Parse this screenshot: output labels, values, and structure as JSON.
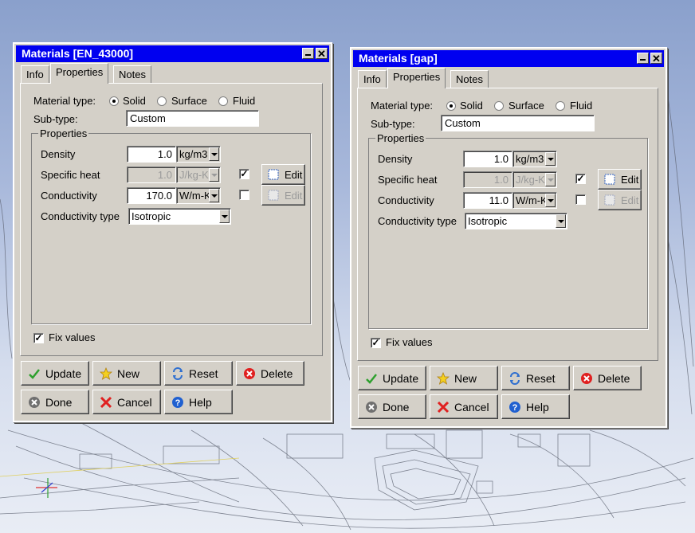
{
  "colors": {
    "titlebar": "#0000f0",
    "dialog_bg": "#d4d0c8",
    "desktop_top": "#8aa0cc"
  },
  "dialogs": [
    {
      "title": "Materials [EN_43000]",
      "tabs": [
        "Info",
        "Properties",
        "Notes"
      ],
      "active_tab": "Properties",
      "material_type_label": "Material type:",
      "material_types": [
        "Solid",
        "Surface",
        "Fluid"
      ],
      "material_type_selected": "Solid",
      "subtype_label": "Sub-type:",
      "subtype_value": "Custom",
      "properties_label": "Properties",
      "density": {
        "label": "Density",
        "value": "1.0",
        "unit": "kg/m3"
      },
      "specific_heat": {
        "label": "Specific heat",
        "value": "1.0",
        "unit": "J/kg-K",
        "checked": true,
        "edit_label": "Edit"
      },
      "conductivity": {
        "label": "Conductivity",
        "value": "170.0",
        "unit": "W/m-K",
        "checked": false,
        "edit_label": "Edit"
      },
      "conductivity_type": {
        "label": "Conductivity type",
        "value": "Isotropic"
      },
      "fix_values": {
        "label": "Fix values",
        "checked": true
      },
      "buttons": {
        "update": "Update",
        "new": "New",
        "reset": "Reset",
        "delete": "Delete",
        "done": "Done",
        "cancel": "Cancel",
        "help": "Help"
      }
    },
    {
      "title": "Materials [gap]",
      "tabs": [
        "Info",
        "Properties",
        "Notes"
      ],
      "active_tab": "Properties",
      "material_type_label": "Material type:",
      "material_types": [
        "Solid",
        "Surface",
        "Fluid"
      ],
      "material_type_selected": "Solid",
      "subtype_label": "Sub-type:",
      "subtype_value": "Custom",
      "properties_label": "Properties",
      "density": {
        "label": "Density",
        "value": "1.0",
        "unit": "kg/m3"
      },
      "specific_heat": {
        "label": "Specific heat",
        "value": "1.0",
        "unit": "J/kg-K",
        "checked": true,
        "edit_label": "Edit"
      },
      "conductivity": {
        "label": "Conductivity",
        "value": "11.0",
        "unit": "W/m-K",
        "checked": false,
        "edit_label": "Edit"
      },
      "conductivity_type": {
        "label": "Conductivity type",
        "value": "Isotropic"
      },
      "fix_values": {
        "label": "Fix values",
        "checked": true
      },
      "buttons": {
        "update": "Update",
        "new": "New",
        "reset": "Reset",
        "delete": "Delete",
        "done": "Done",
        "cancel": "Cancel",
        "help": "Help"
      }
    }
  ]
}
